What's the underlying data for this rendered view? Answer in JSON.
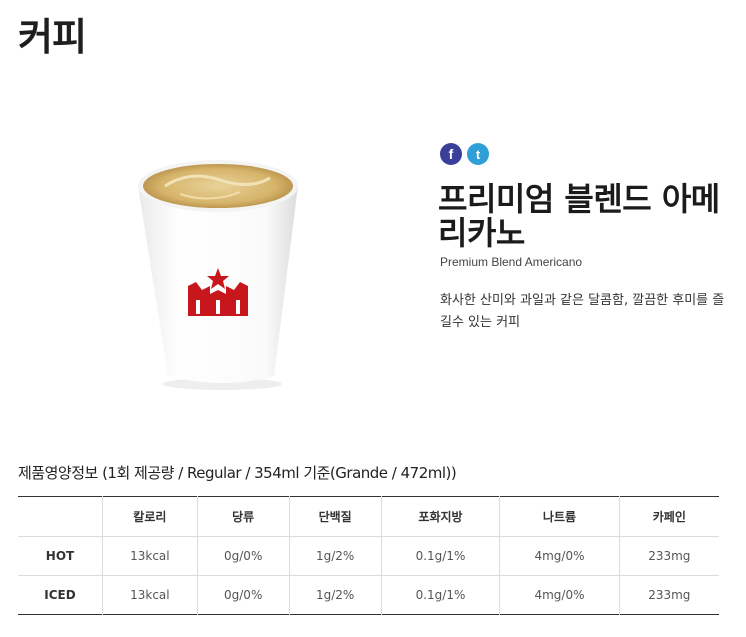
{
  "page": {
    "title": "커피"
  },
  "product": {
    "name": "프리미엄 블렌드 아메리카노",
    "name_en": "Premium Blend Americano",
    "description": "화사한 산미와 과일과 같은 달콤함, 깔끔한 후미를 즐길수 있는 커피",
    "image": "white paper coffee cup with red crown logo and latte foam"
  },
  "social": {
    "facebook": "f",
    "twitter": "t"
  },
  "nutrition": {
    "title": "제품영양정보 (1회 제공량 / Regular / 354ml 기준(Grande / 472ml))",
    "headers": [
      "",
      "칼로리",
      "당류",
      "단백질",
      "포화지방",
      "나트륨",
      "카페인"
    ],
    "rows": [
      {
        "label": "HOT",
        "values": [
          "13kcal",
          "0g/0%",
          "1g/2%",
          "0.1g/1%",
          "4mg/0%",
          "233mg"
        ]
      },
      {
        "label": "ICED",
        "values": [
          "13kcal",
          "0g/0%",
          "1g/2%",
          "0.1g/1%",
          "4mg/0%",
          "233mg"
        ]
      }
    ]
  },
  "colors": {
    "facebook": "#3a3f9a",
    "twitter": "#2f9fd8",
    "logo_red": "#c8161d"
  }
}
